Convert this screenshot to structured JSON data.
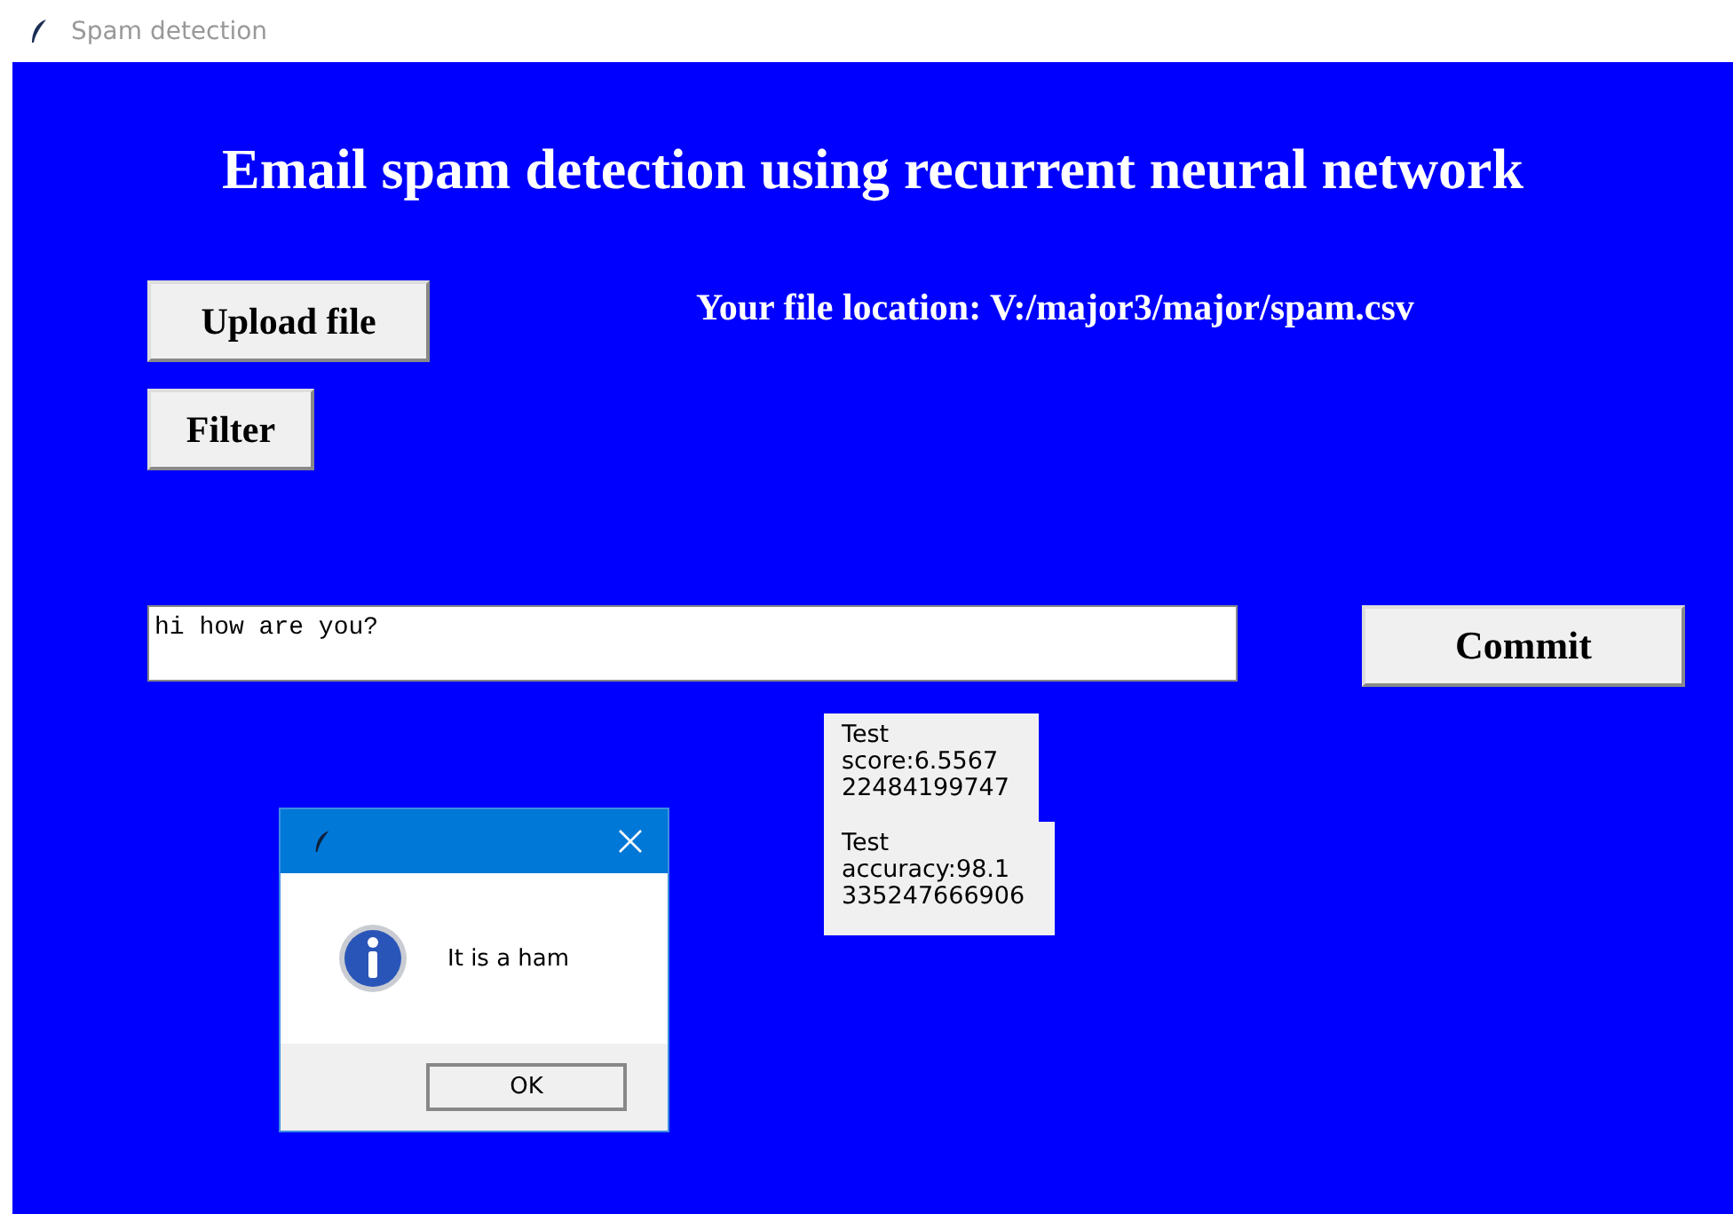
{
  "window": {
    "title": "Spam detection"
  },
  "heading": "Email spam detection using recurrent neural network",
  "buttons": [
    {
      "label": "Upload file"
    },
    {
      "label": "Filter"
    },
    {
      "label": "Commit"
    }
  ],
  "file_location": "Your file location: V:/major3/major/spam.csv",
  "message_field": {
    "value": "hi how are you?"
  },
  "results": [
    "Test\nscore:6.5567\n22484199747",
    "Test\naccuracy:98.1\n335247666906"
  ],
  "dialog": {
    "message": "It is a ham",
    "button": "OK"
  }
}
